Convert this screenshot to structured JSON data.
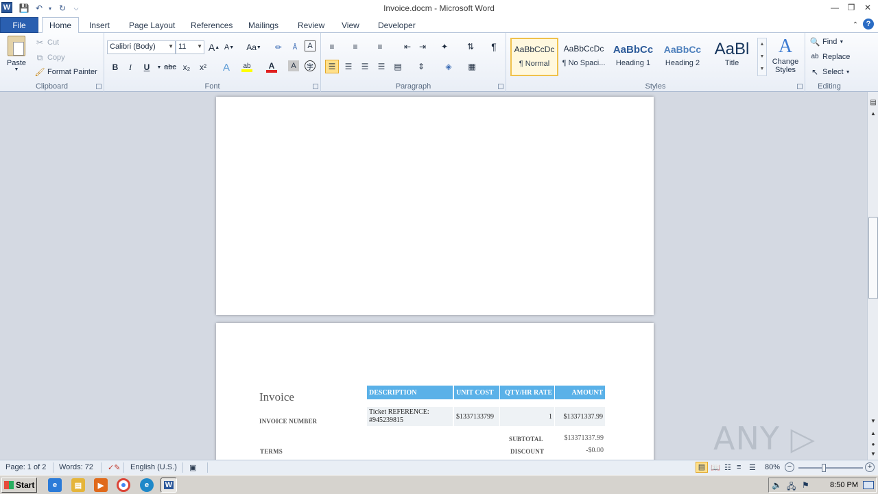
{
  "window": {
    "title": "Invoice.docm - Microsoft Word",
    "app_logo": "W"
  },
  "tabs": [
    "File",
    "Home",
    "Insert",
    "Page Layout",
    "References",
    "Mailings",
    "Review",
    "View",
    "Developer"
  ],
  "active_tab": "Home",
  "clipboard": {
    "group_label": "Clipboard",
    "paste": "Paste",
    "cut": "Cut",
    "copy": "Copy",
    "format_painter": "Format Painter"
  },
  "font": {
    "group_label": "Font",
    "font_name": "Calibri (Body)",
    "font_size": "11",
    "bold": "B",
    "italic": "I",
    "underline": "U",
    "strikethrough": "abc",
    "subscript": "x₂",
    "superscript": "x²",
    "grow": "A",
    "shrink": "A",
    "change_case": "Aa"
  },
  "paragraph": {
    "group_label": "Paragraph",
    "pilcrow": "¶"
  },
  "styles": {
    "group_label": "Styles",
    "items": [
      {
        "sample": "AaBbCcDc",
        "name": "¶ Normal"
      },
      {
        "sample": "AaBbCcDc",
        "name": "¶ No Spaci..."
      },
      {
        "sample": "AaBbCc",
        "name": "Heading 1"
      },
      {
        "sample": "AaBbCc",
        "name": "Heading 2"
      },
      {
        "sample": "AaBl",
        "name": "Title"
      }
    ],
    "change_styles": "Change Styles"
  },
  "editing": {
    "group_label": "Editing",
    "find": "Find",
    "replace": "Replace",
    "select": "Select"
  },
  "invoice": {
    "title": "Invoice",
    "invoice_number_label": "INVOICE NUMBER",
    "terms_label": "TERMS",
    "headers": [
      "DESCRIPTION",
      "UNIT COST",
      "QTY/HR RATE",
      "AMOUNT"
    ],
    "row": {
      "description": "Ticket REFERENCE: #945239815",
      "unit_cost": "$1337133799",
      "qty": "1",
      "amount": "$13371337.99"
    },
    "subtotal_label": "SUBTOTAL",
    "subtotal_value": "$13371337.99",
    "discount_label": "DISCOUNT",
    "discount_value": "-$0.00"
  },
  "statusbar": {
    "page": "Page: 1 of 2",
    "words": "Words: 72",
    "language": "English (U.S.)",
    "zoom": "80%",
    "zoom_fraction": 0.8
  },
  "taskbar": {
    "start": "Start",
    "clock": "8:50 PM"
  },
  "watermark": "ANY ▷ RUN"
}
